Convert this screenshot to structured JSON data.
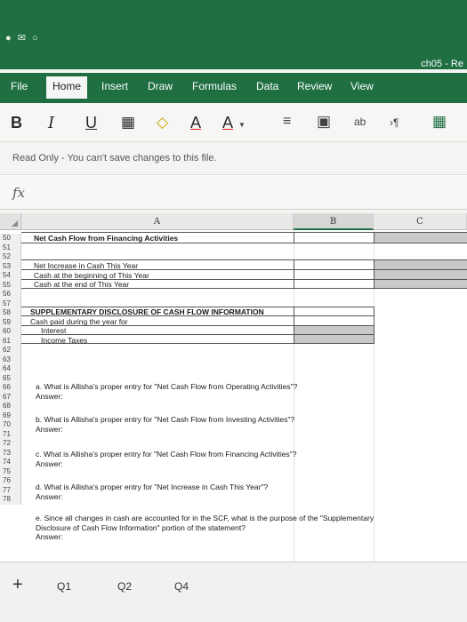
{
  "window": {
    "doc_title": "ch05 - Re"
  },
  "ribbon": {
    "tabs": [
      "File",
      "Home",
      "Insert",
      "Draw",
      "Formulas",
      "Data",
      "Review",
      "View"
    ],
    "active_tab": "Home",
    "buttons": {
      "bold": "B",
      "italic": "I",
      "underline": "U",
      "font_color": "A",
      "highlight_color": "A",
      "wrap": "ab"
    }
  },
  "notice": "Read Only - You can't save changes to this file.",
  "formula_bar": {
    "fx": "fx"
  },
  "sheet": {
    "columns": [
      "A",
      "B",
      "C"
    ],
    "rows": [
      "50",
      "51",
      "52",
      "53",
      "54",
      "55",
      "56",
      "57",
      "58",
      "59",
      "60",
      "61",
      "62",
      "63",
      "64",
      "65",
      "66",
      "67",
      "68",
      "69",
      "70",
      "71",
      "72",
      "73",
      "74",
      "75",
      "76",
      "77",
      "78"
    ],
    "cells": {
      "r50": "Net Cash Flow from Financing Activities",
      "r52": "Net Increase in Cash This Year",
      "r53": "Cash at the beginning of This Year",
      "r54": "Cash at the end of This Year",
      "r56": "SUPPLEMENTARY DISCLOSURE OF CASH FLOW INFORMATION",
      "r57": "Cash paid during the year for",
      "r58": "Interest",
      "r59": "Income Taxes",
      "r62": "a. What is Allisha's proper entry for \"Net Cash Flow from Operating Activities\"?",
      "r63": "Answer:",
      "r65": "b. What is Allisha's proper entry for \"Net Cash Flow from Investing Activities\"?",
      "r66": "Answer:",
      "r68": "c. What is Allisha's proper entry for \"Net Cash Flow from Financing Activities\"?",
      "r69": "Answer:",
      "r71": "d. What is Allisha's proper entry for \"Net Increase in Cash This Year\"?",
      "r72": "Answer:",
      "r74": "e. Since all changes in cash are accounted for in the SCF, what is the purpose of the \"Supplementary",
      "r75": "Disclosure of Cash Flow Information\" portion of the statement?",
      "r76": "Answer:"
    }
  },
  "sheet_tabs": [
    "Q1",
    "Q2",
    "Q4"
  ]
}
